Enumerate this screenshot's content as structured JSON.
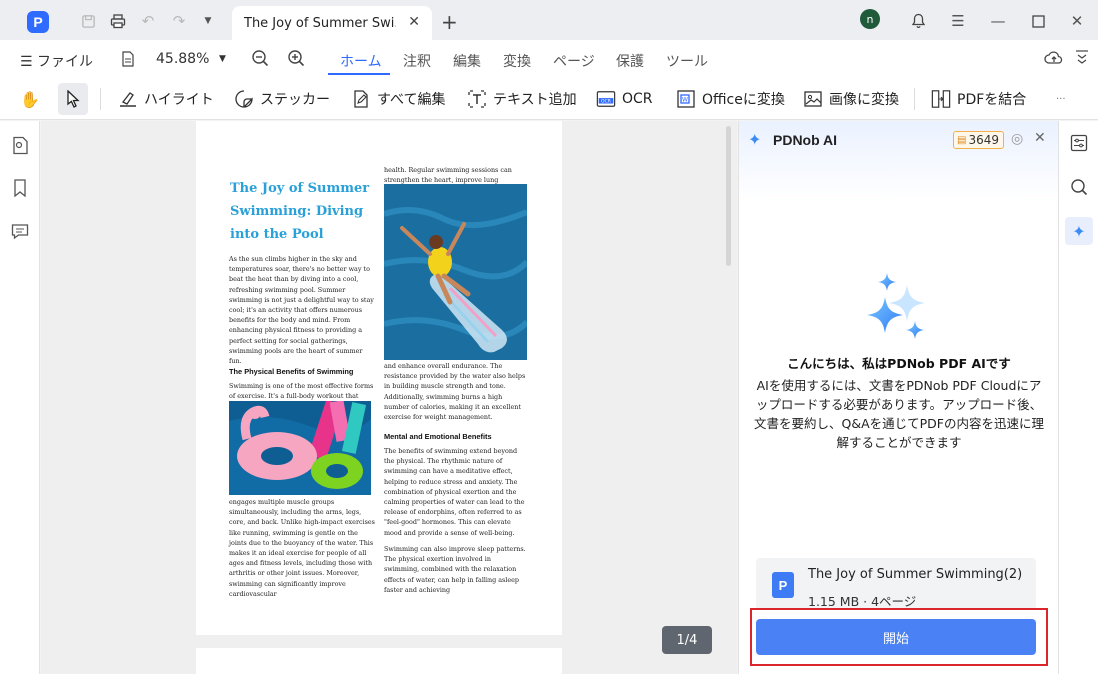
{
  "titlebar": {
    "app_logo": "P",
    "tab_title": "The Joy of Summer Swi...",
    "avatar_letter": "n"
  },
  "menubar": {
    "file_label": "ファイル",
    "zoom_value": "45.88%",
    "ribbon_tabs": [
      "ホーム",
      "注釈",
      "編集",
      "変換",
      "ページ",
      "保護",
      "ツール"
    ],
    "active_tab_index": 0
  },
  "toolbar": {
    "highlight_label": "ハイライト",
    "sticker_label": "ステッカー",
    "edit_all_label": "すべて編集",
    "add_text_label": "テキスト追加",
    "ocr_label": "OCR",
    "to_office_label": "Officeに変換",
    "to_image_label": "画像に変換",
    "combine_pdf_label": "PDFを結合",
    "more_label": "···"
  },
  "document": {
    "title": "The Joy of Summer Swimming: Diving into the Pool",
    "intro": "As the sun climbs higher in the sky and temperatures soar, there's no better way to beat the heat than by diving into a cool, refreshing swimming pool. Summer swimming is not just a delightful way to stay cool; it's an activity that offers numerous benefits for the body and mind. From enhancing physical fitness to providing a perfect setting for social gatherings, swimming pools are the heart of summer fun.",
    "heading1": "The Physical Benefits of Swimming",
    "para1a": "Swimming is one of the most effective forms of exercise. It's a full-body workout that",
    "para1b": "engages multiple muscle groups simultaneously, including the arms, legs, core, and back. Unlike high-impact exercises like running, swimming is gentle on the joints due to the buoyancy of the water. This makes it an ideal exercise for people of all ages and fitness levels, including those with arthritis or other joint issues. Moreover, swimming can significantly improve cardiovascular",
    "col2_top": "health. Regular swimming sessions can strengthen the heart, improve lung capacity,",
    "col2_mid": "and enhance overall endurance. The resistance provided by the water also helps in building muscle strength and tone. Additionally, swimming burns a high number of calories, making it an excellent exercise for weight management.",
    "heading2": "Mental and Emotional Benefits",
    "para2": "The benefits of swimming extend beyond the physical. The rhythmic nature of swimming can have a meditative effect, helping to reduce stress and anxiety. The combination of physical exertion and the calming properties of water can lead to the release of endorphins, often referred to as \"feel-good\" hormones. This can elevate mood and provide a sense of well-being.",
    "para3": "Swimming can also improve sleep patterns. The physical exertion involved in swimming, combined with the relaxation effects of water, can help in falling asleep faster and achieving",
    "pager": "1/4"
  },
  "ai_panel": {
    "title": "PDNob AI",
    "credits": "3649",
    "greeting": "こんにちは、私はPDNob PDF AIです",
    "description": "AIを使用するには、文書をPDNob PDF Cloudにアップロードする必要があります。アップロード後、文書を要約し、Q&Aを通じてPDFの内容を迅速に理解することができます",
    "file_name": "The Joy of Summer Swimming(2)",
    "file_meta": "1.15 MB · 4ページ",
    "start_label": "開始"
  },
  "colors": {
    "accent": "#2f6bff",
    "doc_title": "#29a0d8",
    "start_button": "#4a82f5",
    "highlight_frame": "#d9262a"
  }
}
